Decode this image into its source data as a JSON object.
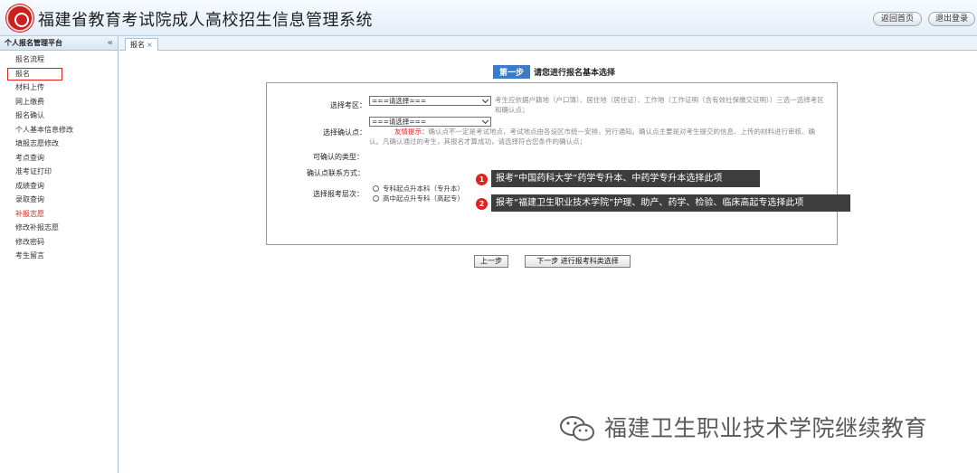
{
  "header": {
    "title": "福建省教育考试院成人高校招生信息管理系统",
    "home_button": "返回首页",
    "logout_button": "退出登录",
    "logo_icon": "seal-logo-icon"
  },
  "sidebar": {
    "title": "个人报名管理平台",
    "collapse_icon": "«",
    "items": [
      {
        "label": "报名流程"
      },
      {
        "label": "报名",
        "active": true
      },
      {
        "label": "材料上传"
      },
      {
        "label": "网上缴费"
      },
      {
        "label": "报名确认"
      },
      {
        "label": "个人基本信息修改"
      },
      {
        "label": "填报志愿修改"
      },
      {
        "label": "考点查询"
      },
      {
        "label": "准考证打印"
      },
      {
        "label": "成绩查询"
      },
      {
        "label": "录取查询"
      },
      {
        "label": "补报志愿",
        "highlight": "#e0221c"
      },
      {
        "label": "修改补报志愿"
      },
      {
        "label": "修改密码"
      },
      {
        "label": "考生留言"
      }
    ]
  },
  "tabs": [
    {
      "label": "报名",
      "close": "×"
    }
  ],
  "step": {
    "badge": "第一步",
    "title": "请您进行报名基本选择"
  },
  "form": {
    "exam_area": {
      "label": "选择考区：",
      "value": "===请选择===",
      "note": "考生应依据户籍地（户口簿）、居住地（居住证）、工作地（工作证明（含有效社保缴交证明））三选一选择考区和确认点；"
    },
    "confirm_point": {
      "label": "选择确认点：",
      "value": "===请选择===",
      "warn_label": "友情提示：",
      "note": "确认点不一定是考试地点，考试地点由各设区市统一安排，另行通知。确认点主要是对考生提交的信息、上传的材料进行审核、确认。凡确认通过的考生，其报名才算成功，请选择符合您条件的确认点；"
    },
    "confirm_type_label": "可确认的类型：",
    "contact_label": "确认点联系方式：",
    "level": {
      "label": "选择报考层次：",
      "options": [
        {
          "label": "专科起点升本科（专升本）"
        },
        {
          "label": "高中起点升专科（高起专）"
        }
      ]
    }
  },
  "callouts": [
    {
      "num": "1",
      "text": "报考“中国药科大学”药学专升本、中药学专升本选择此项"
    },
    {
      "num": "2",
      "text": "报考“福建卫生职业技术学院”护理、助产、药学、检验、临床高起专选择此项"
    }
  ],
  "buttons": {
    "prev": "上一步",
    "next": "下一步 进行报考科类选择"
  },
  "watermark": {
    "icon": "wechat-icon",
    "text": "福建卫生职业技术学院继续教育"
  }
}
